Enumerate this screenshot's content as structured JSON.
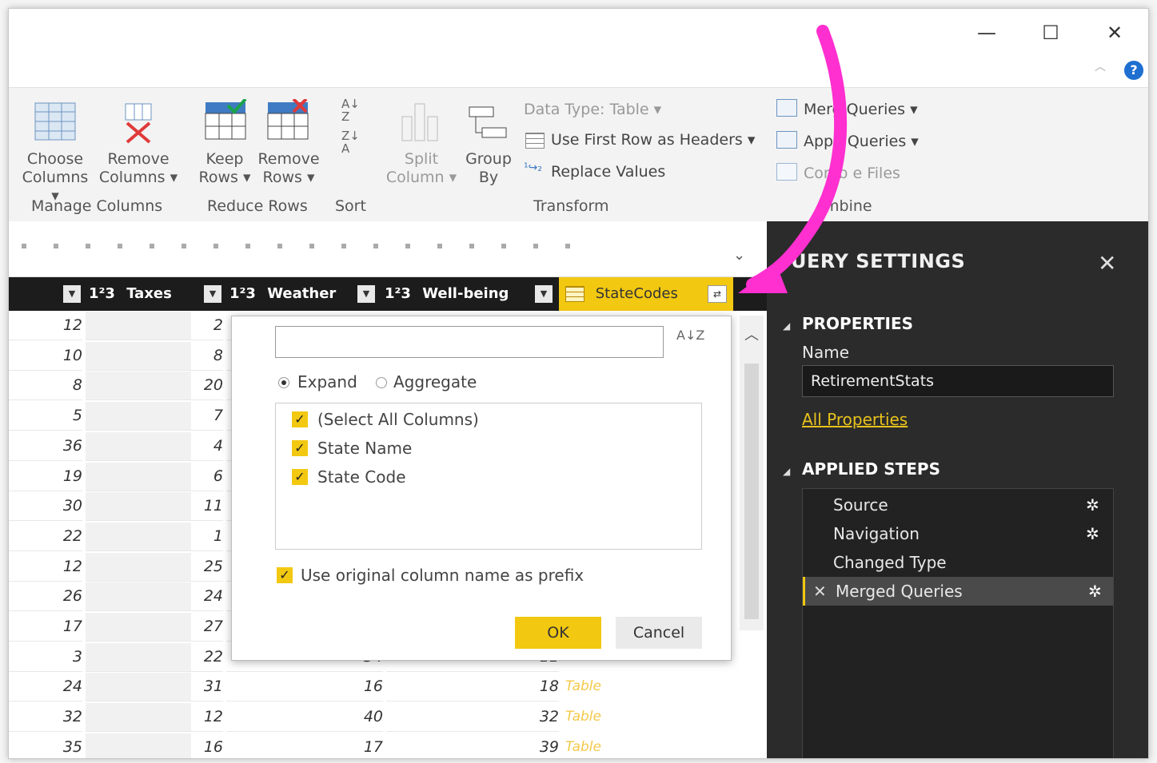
{
  "window": {
    "minimize": "—",
    "maximize": "☐",
    "close": "✕",
    "help": "?"
  },
  "ribbon": {
    "choose_columns": [
      "Choose",
      "Columns ▾"
    ],
    "remove_columns": [
      "Remove",
      "Columns ▾"
    ],
    "keep_rows": [
      "Keep",
      "Rows ▾"
    ],
    "remove_rows": [
      "Remove",
      "Rows ▾"
    ],
    "split_column": [
      "Split",
      "Column ▾"
    ],
    "group_by": [
      "Group",
      "By"
    ],
    "data_type": "Data Type: Table ▾",
    "use_first_row": "Use First Row as Headers ▾",
    "replace_values": "Replace Values",
    "merge_queries": "Merg   Queries ▾",
    "append_queries": "Appe   Queries ▾",
    "combine_files": "Comb   e Files",
    "groups": {
      "manage_columns": "Manage Columns",
      "reduce_rows": "Reduce Rows",
      "sort": "Sort",
      "transform": "Transform",
      "combine": "  mbine"
    }
  },
  "grid": {
    "columns": [
      {
        "name": "Taxes",
        "type": "1²3"
      },
      {
        "name": "Weather",
        "type": "1²3"
      },
      {
        "name": "Well-being",
        "type": "1²3"
      },
      {
        "name": "StateCodes",
        "type": "table"
      }
    ],
    "rows": [
      [
        "12",
        "2",
        "",
        ""
      ],
      [
        "10",
        "8",
        "",
        ""
      ],
      [
        "8",
        "20",
        "",
        ""
      ],
      [
        "5",
        "7",
        "",
        ""
      ],
      [
        "36",
        "4",
        "",
        ""
      ],
      [
        "19",
        "6",
        "",
        ""
      ],
      [
        "30",
        "11",
        "",
        ""
      ],
      [
        "22",
        "1",
        "",
        ""
      ],
      [
        "12",
        "25",
        "",
        ""
      ],
      [
        "26",
        "24",
        "",
        ""
      ],
      [
        "17",
        "27",
        "",
        ""
      ],
      [
        "3",
        "22",
        "34",
        "11"
      ],
      [
        "24",
        "31",
        "16",
        "18"
      ],
      [
        "32",
        "12",
        "40",
        "32"
      ],
      [
        "35",
        "16",
        "17",
        "39"
      ]
    ],
    "table_label": "Table"
  },
  "dialog": {
    "sort_icon": "A↓Z",
    "expand": "Expand",
    "aggregate": "Aggregate",
    "items": [
      "(Select All Columns)",
      "State Name",
      "State Code"
    ],
    "prefix": "Use original column name as prefix",
    "ok": "OK",
    "cancel": "Cancel"
  },
  "settings": {
    "title": "UERY SETTINGS",
    "properties": "PROPERTIES",
    "name_label": "Name",
    "name_value": "RetirementStats",
    "all_properties": "All Properties",
    "applied_steps": "APPLIED STEPS",
    "steps": [
      "Source",
      "Navigation",
      "Changed Type",
      "Merged Queries"
    ]
  },
  "colors": {
    "accent": "#f2c811",
    "arrow": "#ff2fd0",
    "dark": "#2b2b2b"
  }
}
